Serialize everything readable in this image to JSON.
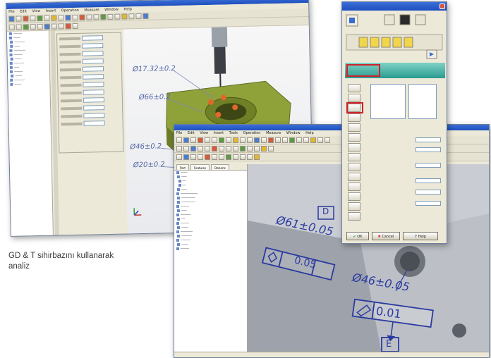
{
  "caption": {
    "line1": "GD & T sihirbazını kullanarak",
    "line2": "analiz"
  },
  "back_window": {
    "menu": [
      "File",
      "Edit",
      "View",
      "Insert",
      "Operation",
      "Measure",
      "Window",
      "Help"
    ],
    "dimensions": [
      "Ø17.32±0.2",
      "Ø66±0.2",
      "Ø46±0.2",
      "Ø20±0.2"
    ]
  },
  "front_window": {
    "menu": [
      "File",
      "Edit",
      "View",
      "Insert",
      "Tools",
      "Operation",
      "Measure",
      "Window",
      "Help"
    ],
    "tabs": [
      "Part",
      "Features",
      "Datums"
    ],
    "dimension_label": "Ø46±0.05",
    "dimension_label_2": "Ø61±0.05",
    "tolerance_value": "0.01",
    "tolerance_value_2": "0.05",
    "datum_letter": "E",
    "datum_letter_2": "D"
  },
  "dialog": {
    "ok_label": "OK",
    "cancel_label": "Cancel",
    "help_label": "Help"
  },
  "colors": {
    "accent_red": "#d0202a",
    "teal": "#2a9b8f",
    "dimension_blue": "#5568a8",
    "part_green": "#8fa23a"
  }
}
